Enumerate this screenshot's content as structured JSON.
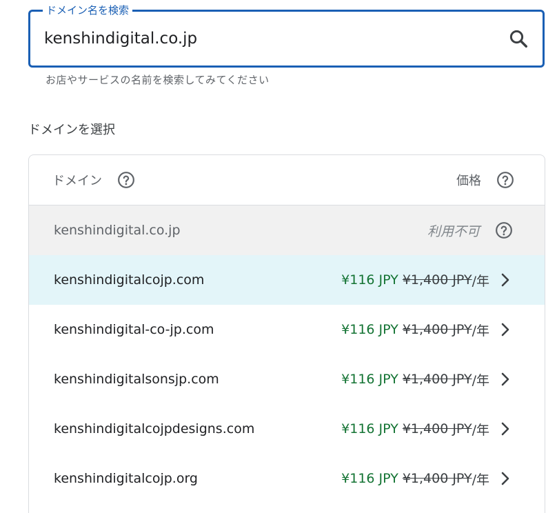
{
  "search": {
    "legend": "ドメイン名を検索",
    "value": "kenshindigital.co.jp",
    "hint": "お店やサービスの名前を検索してみてください"
  },
  "section_title": "ドメインを選択",
  "table": {
    "header_domain": "ドメイン",
    "header_price": "価格",
    "unavailable": {
      "name": "kenshindigital.co.jp",
      "status": "利用不可"
    },
    "rows": [
      {
        "name": "kenshindigitalcojp.com",
        "sale": "¥116 JPY",
        "orig": "¥1,400 JPY",
        "per": "/年"
      },
      {
        "name": "kenshindigital-co-jp.com",
        "sale": "¥116 JPY",
        "orig": "¥1,400 JPY",
        "per": "/年"
      },
      {
        "name": "kenshindigitalsonsjp.com",
        "sale": "¥116 JPY",
        "orig": "¥1,400 JPY",
        "per": "/年"
      },
      {
        "name": "kenshindigitalcojpdesigns.com",
        "sale": "¥116 JPY",
        "orig": "¥1,400 JPY",
        "per": "/年"
      },
      {
        "name": "kenshindigitalcojp.org",
        "sale": "¥116 JPY",
        "orig": "¥1,400 JPY",
        "per": "/年"
      }
    ]
  },
  "colors": {
    "accent": "#1a5fb4",
    "price_green": "#137333",
    "highlight_row": "#e3f5f9",
    "unavailable_row": "#f1f1f1"
  },
  "icons": {
    "search": "search-icon",
    "help": "help-circle-icon",
    "chevron": "chevron-right-icon"
  }
}
